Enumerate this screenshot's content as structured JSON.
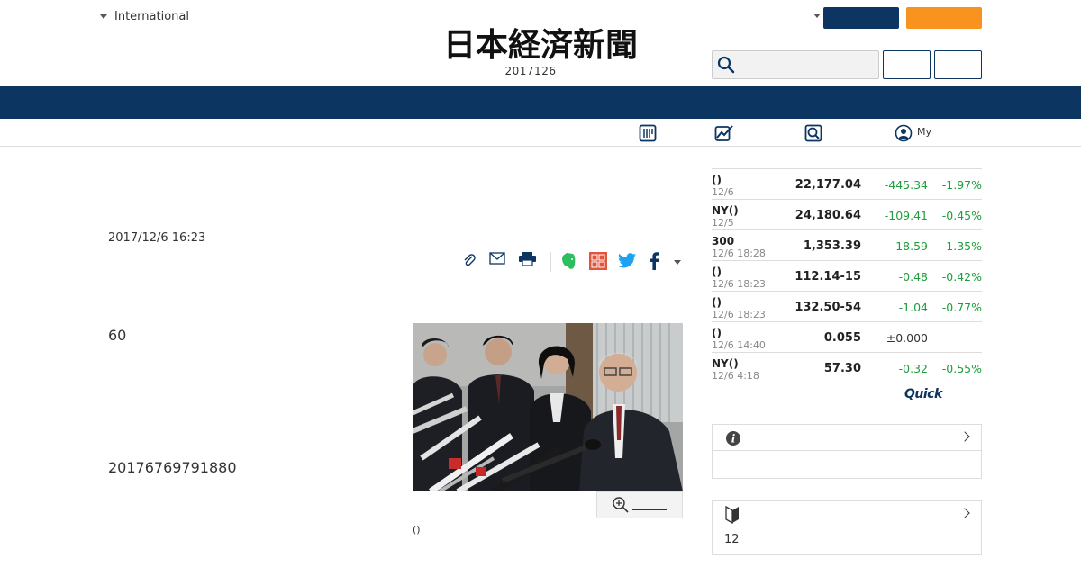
{
  "header": {
    "region_label": "International",
    "edition_date": "2017126",
    "logo_text": "日本経済新聞"
  },
  "subnav": {
    "my_label": "My"
  },
  "article": {
    "date": "2017/12/6 16:23",
    "paragraphs": [
      "60",
      "20176769791880"
    ],
    "caption": "()"
  },
  "market": {
    "rows": [
      {
        "name": "()",
        "time": "12/6",
        "value": "22,177.04",
        "change": "-445.34",
        "pct": "-1.97%"
      },
      {
        "name": "NY()",
        "time": "12/5",
        "value": "24,180.64",
        "change": "-109.41",
        "pct": "-0.45%"
      },
      {
        "name": "300",
        "time": "12/6 18:28",
        "value": "1,353.39",
        "change": "-18.59",
        "pct": "-1.35%"
      },
      {
        "name": "()",
        "time": "12/6 18:23",
        "value": "112.14-15",
        "change": "-0.48",
        "pct": "-0.42%"
      },
      {
        "name": "()",
        "time": "12/6 18:23",
        "value": "132.50-54",
        "change": "-1.04",
        "pct": "-0.77%"
      },
      {
        "name": "()",
        "time": "12/6 14:40",
        "value": "0.055",
        "change": "±0.000",
        "pct": ""
      },
      {
        "name": "NY()",
        "time": "12/6 4:18",
        "value": "57.30",
        "change": "-0.32",
        "pct": "-0.55%"
      }
    ],
    "provider_logo": "Quick"
  },
  "side_boxes": {
    "beginner_count": "12"
  },
  "colors": {
    "brand_navy": "#0d3561",
    "accent_orange": "#f7931e",
    "positive_green": "#1e9e3c"
  }
}
